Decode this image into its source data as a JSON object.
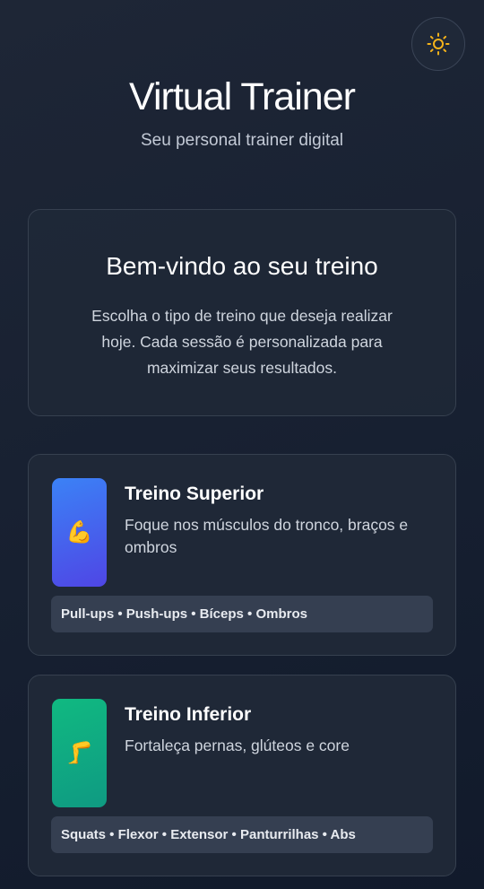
{
  "header": {
    "title": "Virtual Trainer",
    "subtitle": "Seu personal trainer digital",
    "theme_toggle_icon": "sun-icon",
    "accent_color": "#f5b31a"
  },
  "welcome": {
    "title": "Bem-vindo ao seu treino",
    "text": "Escolha o tipo de treino que deseja realizar hoje. Cada sessão é personalizada para maximizar seus resultados."
  },
  "workouts": [
    {
      "title": "Treino Superior",
      "description": "Foque nos músculos do tronco, braços e ombros",
      "icon": "💪",
      "icon_name": "flexed-biceps-icon",
      "exercises": "Pull-ups • Push-ups • Bíceps • Ombros",
      "colors": [
        "#3b82f6",
        "#4f46e5"
      ]
    },
    {
      "title": "Treino Inferior",
      "description": "Fortaleça pernas, glúteos e core",
      "icon": "🦵",
      "icon_name": "leg-icon",
      "exercises": "Squats • Flexor • Extensor • Panturrilhas • Abs",
      "colors": [
        "#10b981",
        "#0f9a82"
      ]
    }
  ]
}
